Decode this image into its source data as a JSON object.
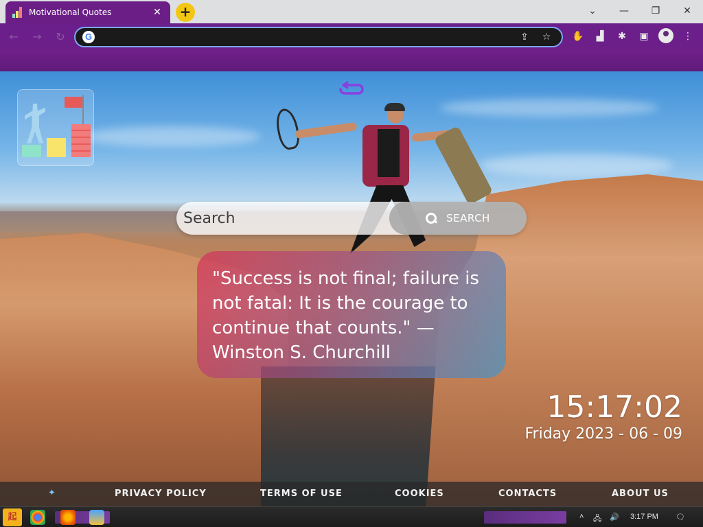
{
  "browser": {
    "tab_title": "Motivational Quotes",
    "tab_close": "✕",
    "new_tab": "+",
    "window_controls": {
      "dropdown": "⌄",
      "minimize": "—",
      "restore": "❐",
      "close": "✕"
    },
    "nav": {
      "back": "←",
      "forward": "→",
      "reload": "↻"
    },
    "omnibox": {
      "value": "",
      "placeholder": "",
      "engine_icon": "G"
    },
    "accent_color": "#6a1f8c"
  },
  "page": {
    "search": {
      "placeholder": "Search",
      "button_label": "SEARCH"
    },
    "quote": {
      "text": "\"Success is not final; failure is not fatal: It is the courage to continue that counts.\" — Winston S. Churchill"
    },
    "clock": {
      "time": "15:17:02",
      "date": "Friday 2023 - 06 - 09"
    },
    "footer": {
      "links": [
        "PRIVACY POLICY",
        "TERMS OF USE",
        "COOKIES",
        "CONTACTS",
        "ABOUT US"
      ]
    }
  },
  "taskbar": {
    "start_label": "起",
    "time": "3:17 PM"
  }
}
